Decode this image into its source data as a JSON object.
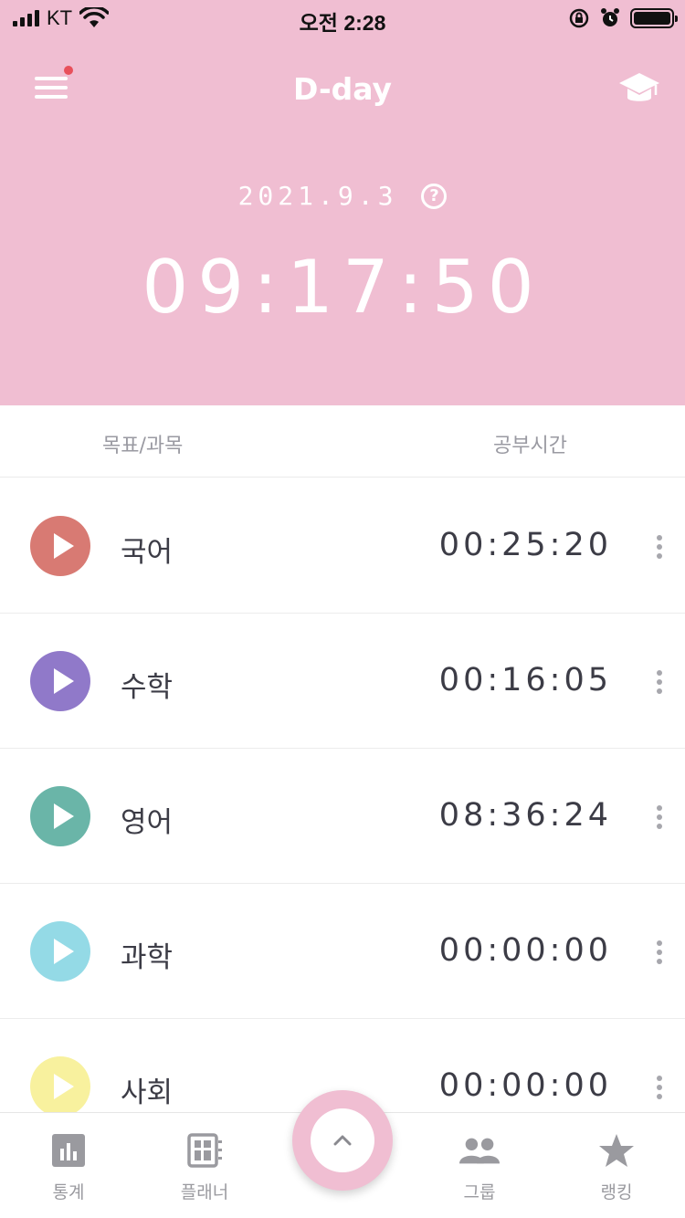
{
  "status_bar": {
    "carrier": "KT",
    "time": "오전 2:28"
  },
  "header": {
    "title": "D-day",
    "dday_date": "2021.9.3",
    "help_glyph": "?",
    "total_time": "09:17:50",
    "background": "#f0bed2",
    "menu_badge_color": "#e8505b"
  },
  "columns": {
    "subject": "목표/과목",
    "study_time": "공부시간"
  },
  "subjects": [
    {
      "name": "국어",
      "time": "00:25:20",
      "color": "#d87a73"
    },
    {
      "name": "수학",
      "time": "00:16:05",
      "color": "#9079c9"
    },
    {
      "name": "영어",
      "time": "08:36:24",
      "color": "#6ab5a8"
    },
    {
      "name": "과학",
      "time": "00:00:00",
      "color": "#94dae6"
    },
    {
      "name": "사회",
      "time": "00:00:00",
      "color": "#f8f19e"
    }
  ],
  "tabbar": {
    "stats": "통계",
    "planner": "플래너",
    "group": "그룹",
    "ranking": "랭킹"
  },
  "icons": {
    "menu": "menu-icon",
    "graduation_cap": "graduation-cap-icon",
    "help": "help-icon",
    "play": "play-icon",
    "more": "more-vertical-icon",
    "stats": "bar-chart-icon",
    "planner": "planner-icon",
    "group": "group-icon",
    "ranking": "star-icon",
    "fab": "chevron-up-icon"
  }
}
